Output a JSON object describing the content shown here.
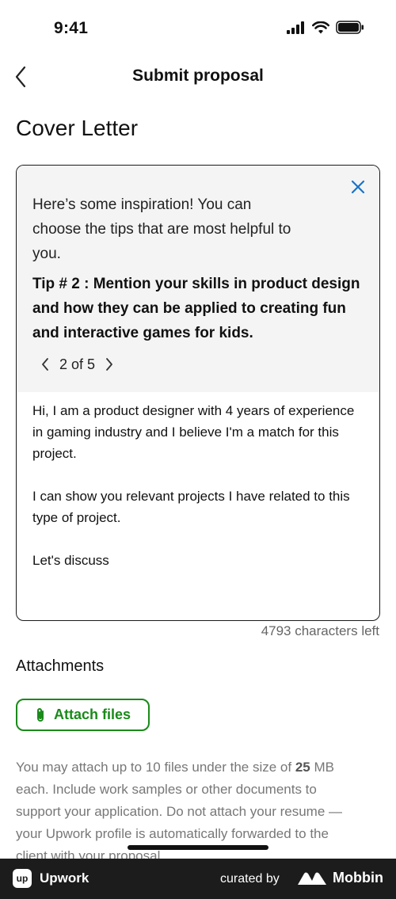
{
  "status_bar": {
    "time": "9:41"
  },
  "nav": {
    "title": "Submit proposal"
  },
  "cover_letter": {
    "section_title": "Cover Letter",
    "tip_intro": "Here’s some inspiration! You can choose the tips that are most helpful to you.",
    "tip_text": "Tip # 2 : Mention your skills in product design and how they can be applied to creating fun and interactive games for kids.",
    "pager": "2 of 5",
    "letter_lines": [
      "Hi, I am a product designer with 4 years of experience in gaming industry and I believe I'm a match for this project.",
      "",
      "I can show you relevant projects I have related to this type of project.",
      "",
      "Let's discuss"
    ],
    "chars_left": "4793 characters left"
  },
  "attachments": {
    "title": "Attachments",
    "button_label": "Attach files",
    "help_before": "You may attach up to 10 files under the size of ",
    "help_size": "25",
    "help_after": " MB each. Include work samples or other documents to support your application. Do not attach your resume — your Upwork profile is automatically forwarded to the client with your proposal."
  },
  "footer": {
    "app_logo_text": "up",
    "app_name": "Upwork",
    "curated_by": "curated by",
    "brand_name": "Mobbin"
  },
  "colors": {
    "accent_green": "#1a8a1a",
    "close_blue": "#1a73c9",
    "footer_bg": "#1c1c1c"
  }
}
